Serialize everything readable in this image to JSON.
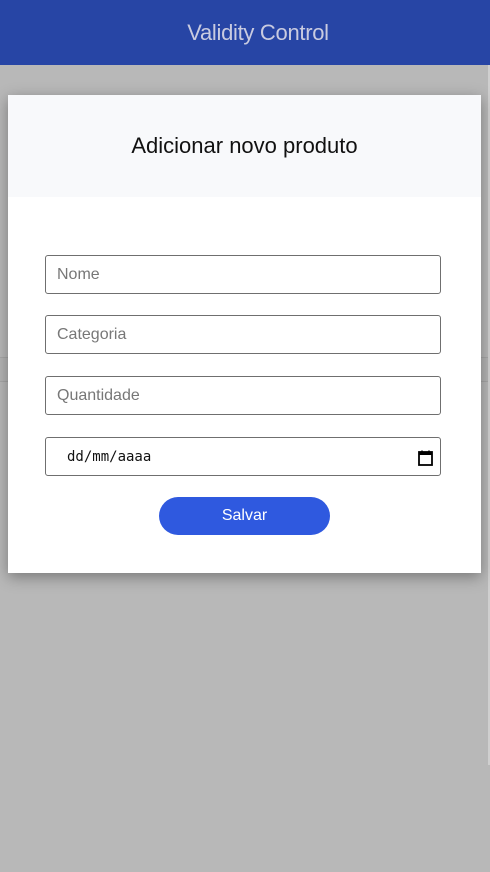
{
  "header": {
    "title": "Validity Control",
    "color": "#2745a5"
  },
  "modal": {
    "title": "Adicionar novo produto",
    "fields": {
      "name_placeholder": "Nome",
      "category_placeholder": "Categoria",
      "quantity_placeholder": "Quantidade",
      "date_value": "dd/mm/aaaa"
    },
    "save_label": "Salvar",
    "save_color": "#2f59df",
    "calendar_icon": "calendar-icon"
  }
}
